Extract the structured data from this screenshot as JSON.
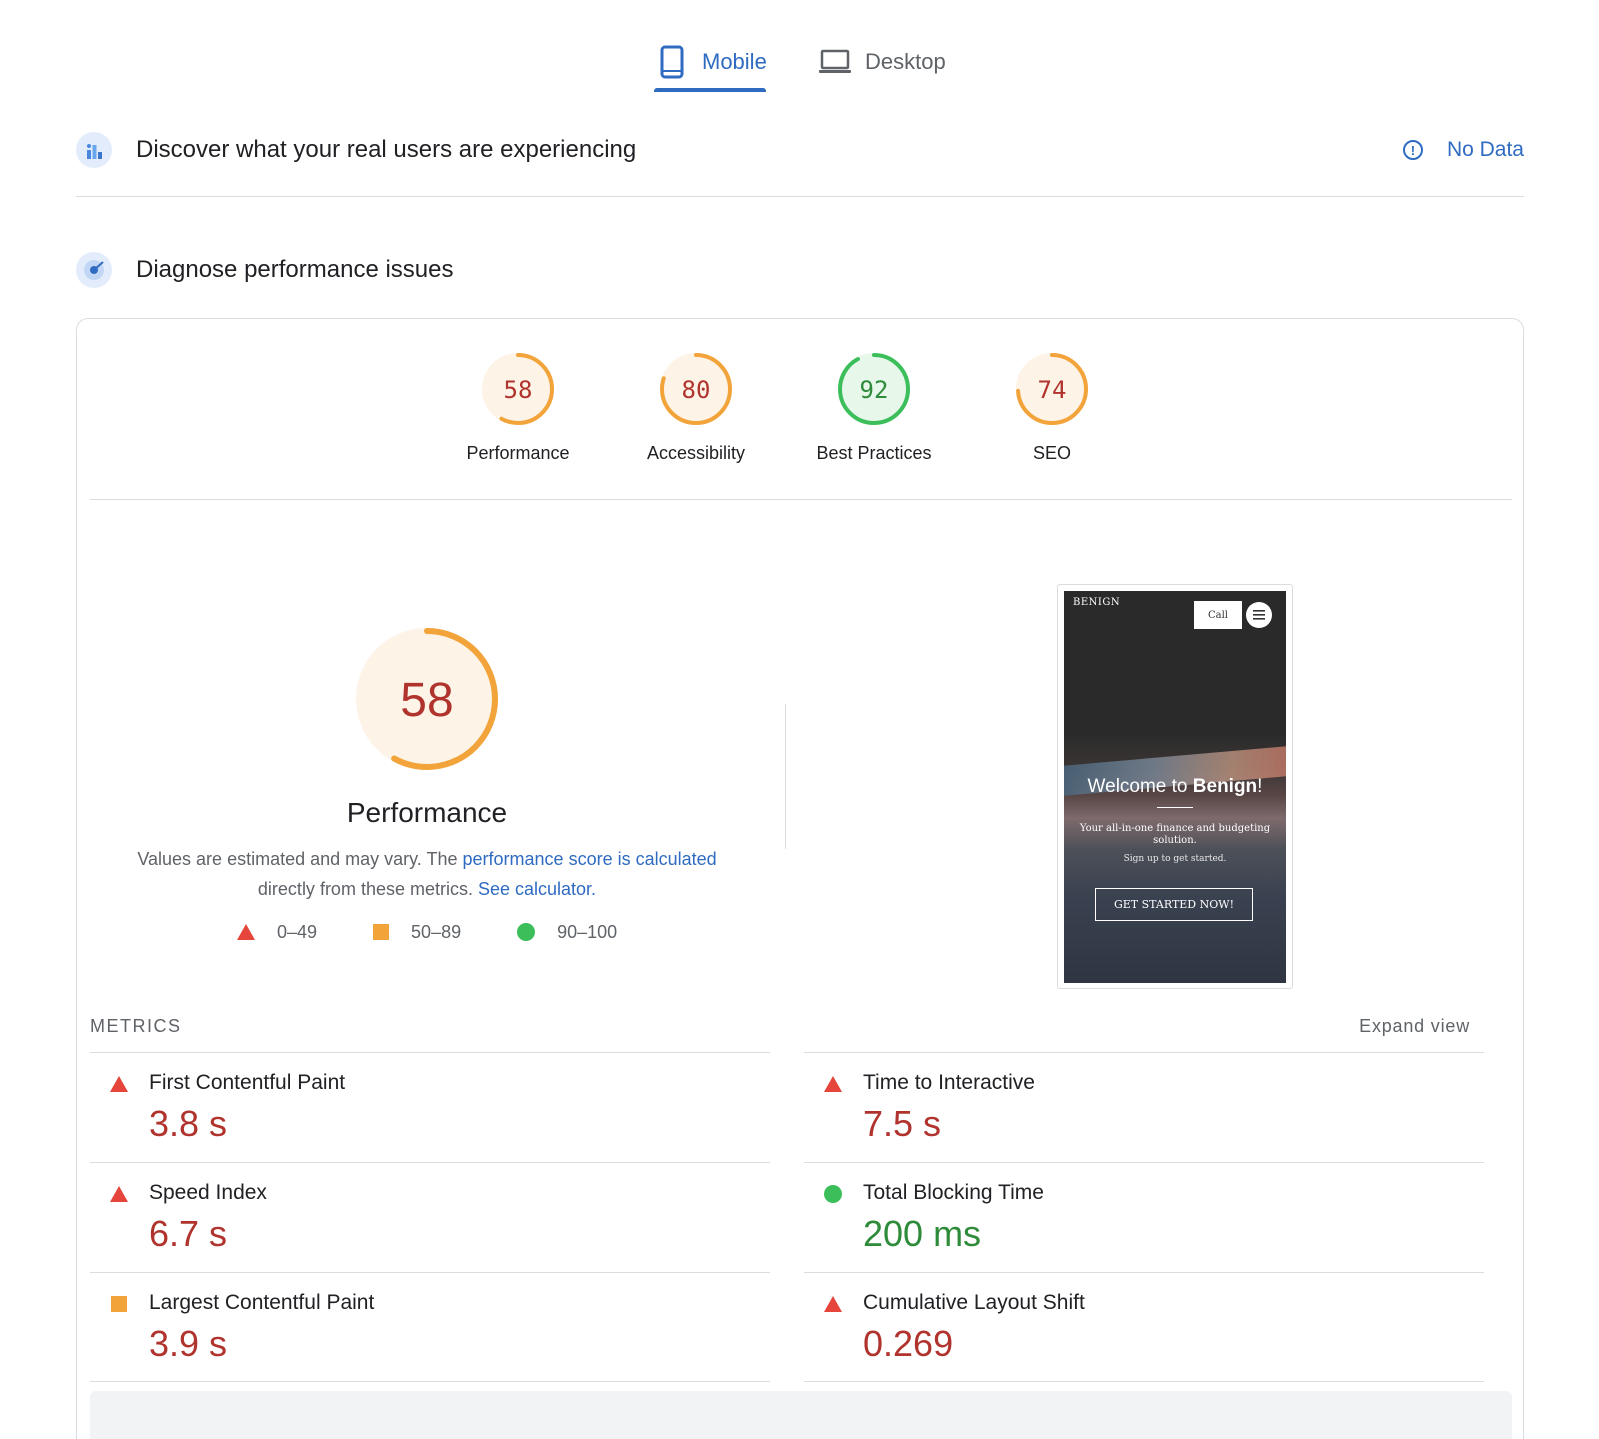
{
  "tabs": {
    "mobile": "Mobile",
    "desktop": "Desktop"
  },
  "field_section": {
    "title": "Discover what your real users are experiencing",
    "status": "No Data"
  },
  "lab_section": {
    "title": "Diagnose performance issues"
  },
  "categories": [
    {
      "label": "Performance",
      "score": "58",
      "level": "average"
    },
    {
      "label": "Accessibility",
      "score": "80",
      "level": "average"
    },
    {
      "label": "Best Practices",
      "score": "92",
      "level": "pass"
    },
    {
      "label": "SEO",
      "score": "74",
      "level": "average"
    }
  ],
  "performance": {
    "score": "58",
    "title": "Performance",
    "note_prefix": "Values are estimated and may vary. The ",
    "note_link": "performance score is calculated",
    "note_middle": " directly from these metrics. ",
    "note_link2": "See calculator.",
    "legend": {
      "fail": "0–49",
      "average": "50–89",
      "pass": "90–100"
    }
  },
  "screenshot": {
    "logo": "BENIGN",
    "call": "Call",
    "welcome_prefix": "Welcome to ",
    "welcome_brand": "Benign",
    "welcome_suffix": "!",
    "subtitle": "Your all-in-one finance and budgeting solution.",
    "subtitle2": "Sign up to get started.",
    "cta": "GET STARTED NOW!"
  },
  "metrics": {
    "label": "METRICS",
    "expand": "Expand view",
    "left": [
      {
        "name": "First Contentful Paint",
        "value": "3.8 s",
        "level": "fail"
      },
      {
        "name": "Speed Index",
        "value": "6.7 s",
        "level": "fail"
      },
      {
        "name": "Largest Contentful Paint",
        "value": "3.9 s",
        "level": "average"
      }
    ],
    "right": [
      {
        "name": "Time to Interactive",
        "value": "7.5 s",
        "level": "fail"
      },
      {
        "name": "Total Blocking Time",
        "value": "200 ms",
        "level": "pass"
      },
      {
        "name": "Cumulative Layout Shift",
        "value": "0.269",
        "level": "fail"
      }
    ]
  },
  "colors": {
    "accent": "#2f6bc1",
    "fail": "#e5453b",
    "average": "#f2a33a",
    "pass": "#3cbf5b",
    "average_text": "#b0332d",
    "pass_text": "#2e8b3a"
  }
}
